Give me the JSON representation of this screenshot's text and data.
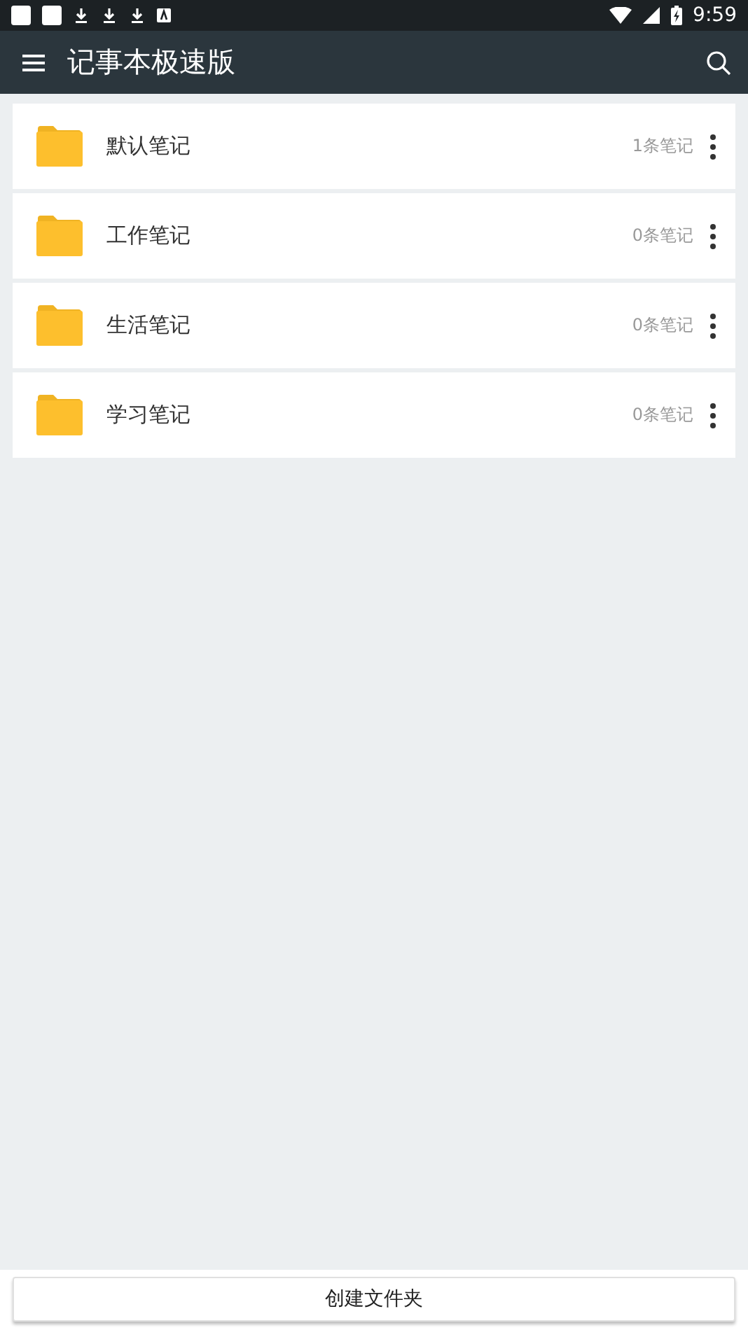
{
  "status_bar": {
    "time": "9:59"
  },
  "toolbar": {
    "title": "记事本极速版"
  },
  "folders": [
    {
      "name": "默认笔记",
      "count": "1条笔记"
    },
    {
      "name": "工作笔记",
      "count": "0条笔记"
    },
    {
      "name": "生活笔记",
      "count": "0条笔记"
    },
    {
      "name": "学习笔记",
      "count": "0条笔记"
    }
  ],
  "create_button": {
    "label": "创建文件夹"
  }
}
